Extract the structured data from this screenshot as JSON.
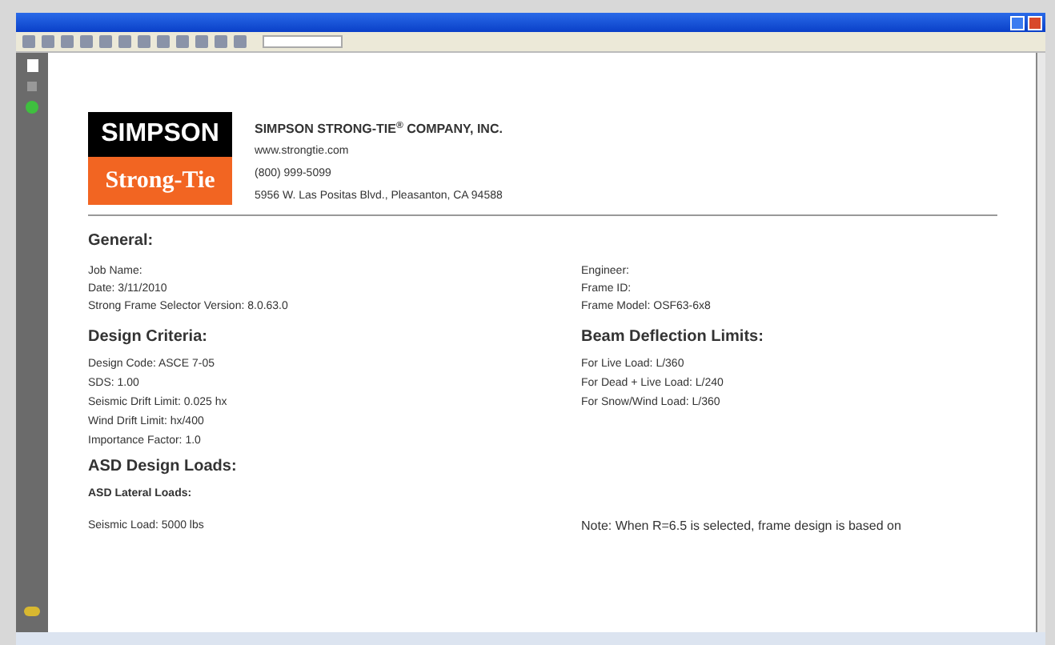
{
  "logo": {
    "top": "SIMPSON",
    "bottom": "Strong-Tie"
  },
  "company": {
    "name": "SIMPSON STRONG-TIE",
    "mark": "®",
    "suffix": " COMPANY, INC.",
    "website": "www.strongtie.com",
    "phone": "(800) 999-5099",
    "address": "5956 W. Las Positas Blvd.,  Pleasanton, CA 94588"
  },
  "general": {
    "heading": "General:",
    "left": [
      "Job Name:",
      "Date:  3/11/2010",
      "Strong Frame Selector Version:  8.0.63.0"
    ],
    "right": [
      "Engineer:",
      "Frame ID:",
      "Frame Model:  OSF63-6x8"
    ]
  },
  "design_criteria": {
    "heading": "Design Criteria:",
    "lines": [
      "Design Code:   ASCE 7-05",
      "SDS:  1.00",
      "Seismic Drift Limit:     0.025 hx",
      "Wind Drift Limit:   hx/400",
      "Importance Factor:  1.0"
    ]
  },
  "beam_deflection": {
    "heading": "Beam Deflection Limits:",
    "lines": [
      "For Live Load:  L/360",
      "For Dead + Live Load:  L/240",
      "For Snow/Wind Load:  L/360"
    ]
  },
  "asd": {
    "heading": "ASD Design Loads:",
    "subheading": "ASD Lateral Loads:",
    "lines": [
      "Seismic Load:  5000 lbs"
    ],
    "note": "Note: When R=6.5 is selected, frame design is based on"
  }
}
